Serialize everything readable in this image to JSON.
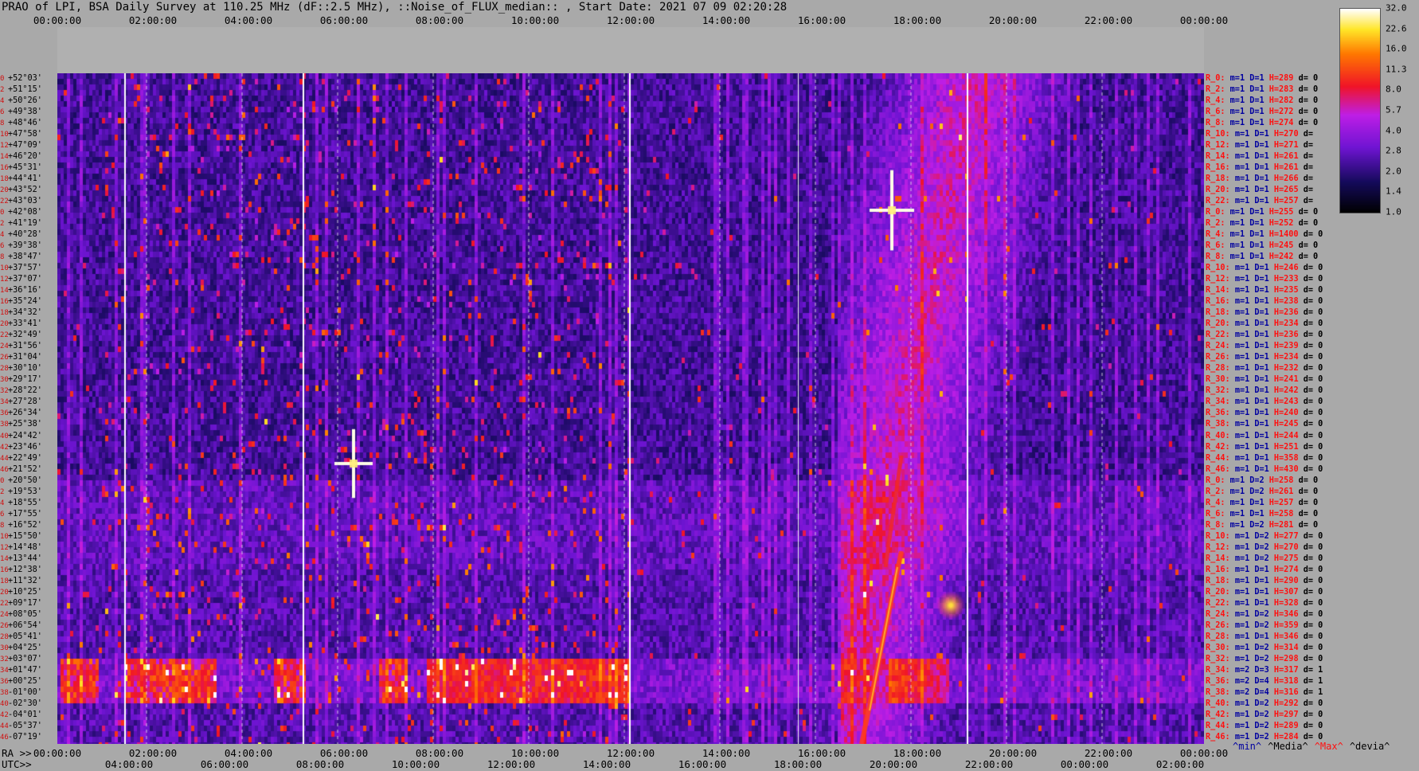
{
  "title": "PRAO of LPI, BSA Daily Survey at 110.25 MHz (dF::2.5 MHz), ::Noise_of_FLUX_median:: , Start Date: 2021 07 09 02:20:28",
  "top_time_ticks": [
    "00:00:00",
    "02:00:00",
    "04:00:00",
    "06:00:00",
    "08:00:00",
    "10:00:00",
    "12:00:00",
    "14:00:00",
    "16:00:00",
    "18:00:00",
    "20:00:00",
    "22:00:00",
    "00:00:00"
  ],
  "ra_prefix": "RA >>",
  "ra_ticks": [
    "00:00:00",
    "02:00:00",
    "04:00:00",
    "06:00:00",
    "08:00:00",
    "10:00:00",
    "12:00:00",
    "14:00:00",
    "16:00:00",
    "18:00:00",
    "20:00:00",
    "22:00:00",
    "00:00:00"
  ],
  "utc_prefix": "UTC>>",
  "utc_ticks": [
    "04:00:00",
    "06:00:00",
    "08:00:00",
    "10:00:00",
    "12:00:00",
    "14:00:00",
    "16:00:00",
    "18:00:00",
    "20:00:00",
    "22:00:00",
    "00:00:00",
    "02:00:00"
  ],
  "declinations": [
    "+52°03'",
    "+51°15'",
    "+50°26'",
    "+49°38'",
    "+48°46'",
    "+47°58'",
    "+47°09'",
    "+46°20'",
    "+45°31'",
    "+44°41'",
    "+43°52'",
    "+43°03'",
    "+42°08'",
    "+41°19'",
    "+40°28'",
    "+39°38'",
    "+38°47'",
    "+37°57'",
    "+37°07'",
    "+36°16'",
    "+35°24'",
    "+34°32'",
    "+33°41'",
    "+32°49'",
    "+31°56'",
    "+31°04'",
    "+30°10'",
    "+29°17'",
    "+28°22'",
    "+27°28'",
    "+26°34'",
    "+25°38'",
    "+24°42'",
    "+23°46'",
    "+22°49'",
    "+21°52'",
    "+20°50'",
    "+19°53'",
    "+18°55'",
    "+17°55'",
    "+16°52'",
    "+15°50'",
    "+14°48'",
    "+13°44'",
    "+12°38'",
    "+11°32'",
    "+10°25'",
    "+09°17'",
    "+08°05'",
    "+06°54'",
    "+05°41'",
    "+04°25'",
    "+03°07'",
    "+01°47'",
    "+00°25'",
    "-01°00'",
    "-02°30'",
    "-04°01'",
    "-05°37'",
    "-07°19'"
  ],
  "dec_indices": [
    "0",
    "2",
    "4",
    "6",
    "8",
    "10",
    "12",
    "14",
    "16",
    "18",
    "20",
    "22",
    "0",
    "2",
    "4",
    "6",
    "8",
    "10",
    "12",
    "14",
    "16",
    "18",
    "20",
    "22",
    "24",
    "26",
    "28",
    "30",
    "32",
    "34",
    "36",
    "38",
    "40",
    "42",
    "44",
    "46",
    "0",
    "2",
    "4",
    "6",
    "8",
    "10",
    "12",
    "14",
    "16",
    "18",
    "20",
    "22",
    "24",
    "26",
    "28",
    "30",
    "32",
    "34",
    "36",
    "38",
    "40",
    "42",
    "44",
    "46"
  ],
  "receivers": [
    {
      "r": "R_0:",
      "m": "m=1",
      "D": "D=1",
      "H": "H=289",
      "d": "d= 0"
    },
    {
      "r": "R_2:",
      "m": "m=1",
      "D": "D=1",
      "H": "H=283",
      "d": "d= 0"
    },
    {
      "r": "R_4:",
      "m": "m=1",
      "D": "D=1",
      "H": "H=282",
      "d": "d= 0"
    },
    {
      "r": "R_6:",
      "m": "m=1",
      "D": "D=1",
      "H": "H=272",
      "d": "d= 0"
    },
    {
      "r": "R_8:",
      "m": "m=1",
      "D": "D=1",
      "H": "H=274",
      "d": "d= 0"
    },
    {
      "r": "R_10:",
      "m": "m=1",
      "D": "D=1",
      "H": "H=270",
      "d": "d="
    },
    {
      "r": "R_12:",
      "m": "m=1",
      "D": "D=1",
      "H": "H=271",
      "d": "d="
    },
    {
      "r": "R_14:",
      "m": "m=1",
      "D": "D=1",
      "H": "H=261",
      "d": "d="
    },
    {
      "r": "R_16:",
      "m": "m=1",
      "D": "D=1",
      "H": "H=261",
      "d": "d="
    },
    {
      "r": "R_18:",
      "m": "m=1",
      "D": "D=1",
      "H": "H=266",
      "d": "d="
    },
    {
      "r": "R_20:",
      "m": "m=1",
      "D": "D=1",
      "H": "H=265",
      "d": "d="
    },
    {
      "r": "R_22:",
      "m": "m=1",
      "D": "D=1",
      "H": "H=257",
      "d": "d="
    },
    {
      "r": "R_0:",
      "m": "m=1",
      "D": "D=1",
      "H": "H=255",
      "d": "d= 0"
    },
    {
      "r": "R_2:",
      "m": "m=1",
      "D": "D=1",
      "H": "H=252",
      "d": "d= 0"
    },
    {
      "r": "R_4:",
      "m": "m=1",
      "D": "D=1",
      "H": "H=1400",
      "d": "d= 0"
    },
    {
      "r": "R_6:",
      "m": "m=1",
      "D": "D=1",
      "H": "H=245",
      "d": "d= 0"
    },
    {
      "r": "R_8:",
      "m": "m=1",
      "D": "D=1",
      "H": "H=242",
      "d": "d= 0"
    },
    {
      "r": "R_10:",
      "m": "m=1",
      "D": "D=1",
      "H": "H=246",
      "d": "d= 0"
    },
    {
      "r": "R_12:",
      "m": "m=1",
      "D": "D=1",
      "H": "H=233",
      "d": "d= 0"
    },
    {
      "r": "R_14:",
      "m": "m=1",
      "D": "D=1",
      "H": "H=235",
      "d": "d= 0"
    },
    {
      "r": "R_16:",
      "m": "m=1",
      "D": "D=1",
      "H": "H=238",
      "d": "d= 0"
    },
    {
      "r": "R_18:",
      "m": "m=1",
      "D": "D=1",
      "H": "H=236",
      "d": "d= 0"
    },
    {
      "r": "R_20:",
      "m": "m=1",
      "D": "D=1",
      "H": "H=234",
      "d": "d= 0"
    },
    {
      "r": "R_22:",
      "m": "m=1",
      "D": "D=1",
      "H": "H=236",
      "d": "d= 0"
    },
    {
      "r": "R_24:",
      "m": "m=1",
      "D": "D=1",
      "H": "H=239",
      "d": "d= 0"
    },
    {
      "r": "R_26:",
      "m": "m=1",
      "D": "D=1",
      "H": "H=234",
      "d": "d= 0"
    },
    {
      "r": "R_28:",
      "m": "m=1",
      "D": "D=1",
      "H": "H=232",
      "d": "d= 0"
    },
    {
      "r": "R_30:",
      "m": "m=1",
      "D": "D=1",
      "H": "H=241",
      "d": "d= 0"
    },
    {
      "r": "R_32:",
      "m": "m=1",
      "D": "D=1",
      "H": "H=242",
      "d": "d= 0"
    },
    {
      "r": "R_34:",
      "m": "m=1",
      "D": "D=1",
      "H": "H=243",
      "d": "d= 0"
    },
    {
      "r": "R_36:",
      "m": "m=1",
      "D": "D=1",
      "H": "H=240",
      "d": "d= 0"
    },
    {
      "r": "R_38:",
      "m": "m=1",
      "D": "D=1",
      "H": "H=245",
      "d": "d= 0"
    },
    {
      "r": "R_40:",
      "m": "m=1",
      "D": "D=1",
      "H": "H=244",
      "d": "d= 0"
    },
    {
      "r": "R_42:",
      "m": "m=1",
      "D": "D=1",
      "H": "H=251",
      "d": "d= 0"
    },
    {
      "r": "R_44:",
      "m": "m=1",
      "D": "D=1",
      "H": "H=358",
      "d": "d= 0"
    },
    {
      "r": "R_46:",
      "m": "m=1",
      "D": "D=1",
      "H": "H=430",
      "d": "d= 0"
    },
    {
      "r": "R_0:",
      "m": "m=1",
      "D": "D=2",
      "H": "H=258",
      "d": "d= 0"
    },
    {
      "r": "R_2:",
      "m": "m=1",
      "D": "D=2",
      "H": "H=261",
      "d": "d= 0"
    },
    {
      "r": "R_4:",
      "m": "m=1",
      "D": "D=1",
      "H": "H=257",
      "d": "d= 0"
    },
    {
      "r": "R_6:",
      "m": "m=1",
      "D": "D=1",
      "H": "H=258",
      "d": "d= 0"
    },
    {
      "r": "R_8:",
      "m": "m=1",
      "D": "D=2",
      "H": "H=281",
      "d": "d= 0"
    },
    {
      "r": "R_10:",
      "m": "m=1",
      "D": "D=2",
      "H": "H=277",
      "d": "d= 0"
    },
    {
      "r": "R_12:",
      "m": "m=1",
      "D": "D=2",
      "H": "H=270",
      "d": "d= 0"
    },
    {
      "r": "R_14:",
      "m": "m=1",
      "D": "D=2",
      "H": "H=275",
      "d": "d= 0"
    },
    {
      "r": "R_16:",
      "m": "m=1",
      "D": "D=1",
      "H": "H=274",
      "d": "d= 0"
    },
    {
      "r": "R_18:",
      "m": "m=1",
      "D": "D=1",
      "H": "H=290",
      "d": "d= 0"
    },
    {
      "r": "R_20:",
      "m": "m=1",
      "D": "D=1",
      "H": "H=307",
      "d": "d= 0"
    },
    {
      "r": "R_22:",
      "m": "m=1",
      "D": "D=1",
      "H": "H=328",
      "d": "d= 0"
    },
    {
      "r": "R_24:",
      "m": "m=1",
      "D": "D=2",
      "H": "H=346",
      "d": "d= 0"
    },
    {
      "r": "R_26:",
      "m": "m=1",
      "D": "D=2",
      "H": "H=359",
      "d": "d= 0"
    },
    {
      "r": "R_28:",
      "m": "m=1",
      "D": "D=1",
      "H": "H=346",
      "d": "d= 0"
    },
    {
      "r": "R_30:",
      "m": "m=1",
      "D": "D=2",
      "H": "H=314",
      "d": "d= 0"
    },
    {
      "r": "R_32:",
      "m": "m=1",
      "D": "D=2",
      "H": "H=298",
      "d": "d= 0"
    },
    {
      "r": "R_34:",
      "m": "m=2",
      "D": "D=3",
      "H": "H=317",
      "d": "d= 1"
    },
    {
      "r": "R_36:",
      "m": "m=2",
      "D": "D=4",
      "H": "H=318",
      "d": "d= 1"
    },
    {
      "r": "R_38:",
      "m": "m=2",
      "D": "D=4",
      "H": "H=316",
      "d": "d= 1"
    },
    {
      "r": "R_40:",
      "m": "m=1",
      "D": "D=2",
      "H": "H=292",
      "d": "d= 0"
    },
    {
      "r": "R_42:",
      "m": "m=1",
      "D": "D=2",
      "H": "H=297",
      "d": "d= 0"
    },
    {
      "r": "R_44:",
      "m": "m=1",
      "D": "D=2",
      "H": "H=289",
      "d": "d= 0"
    },
    {
      "r": "R_46:",
      "m": "m=1",
      "D": "D=2",
      "H": "H=284",
      "d": "d= 0"
    }
  ],
  "colorbar": {
    "labels": [
      "32.0",
      "22.6",
      "16.0",
      "11.3",
      "8.0",
      "5.7",
      "4.0",
      "2.8",
      "2.0",
      "1.4",
      "1.0"
    ]
  },
  "stats_legend": {
    "min": "^min^",
    "media": "^Media^",
    "max": "^Max^",
    "devia": "^devia^"
  },
  "colors": {
    "background": "#a9a9a9",
    "receiver_name": "#ff1010",
    "receiver_mid": "#0000a0",
    "max_label": "#ff1010"
  }
}
